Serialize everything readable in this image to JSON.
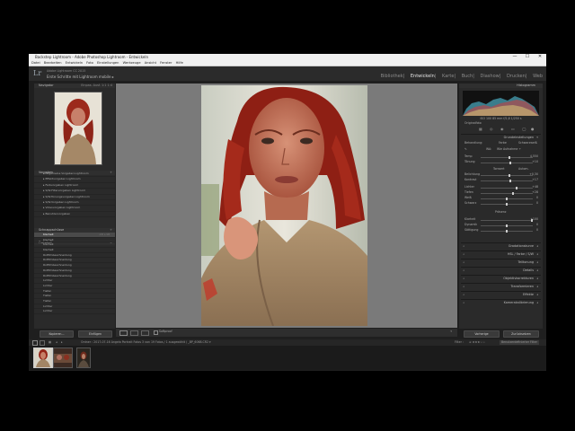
{
  "window": {
    "title": "Backstep Lightroom - Adobe Photoshop Lightroom - Entwickeln",
    "controls": [
      "—",
      "☐",
      "✕"
    ]
  },
  "menu": [
    "Datei",
    "Bearbeiten",
    "Entwickeln",
    "Foto",
    "Einstellungen",
    "Werkzeuge",
    "Ansicht",
    "Fenster",
    "Hilfe"
  ],
  "identity": {
    "logo": "Lr",
    "catalog": "Adobe Lightroom CC 2015",
    "steps": "Erste Schritte mit Lightroom mobile ▸"
  },
  "modules": [
    "Bibliothek",
    "Entwickeln",
    "Karte",
    "Buch",
    "Diashow",
    "Drucken",
    "Web"
  ],
  "active_module": "Entwickeln",
  "left": {
    "navigator": {
      "title": "Navigator",
      "options": "Einpas.  Ausf.  1:1  1:4"
    },
    "presets": {
      "title": "Vorgaben",
      "items": [
        "Allgemeine Vorgaben Lightroom",
        "Effektvorgaben Lightroom",
        "Farbvorgaben Lightroom",
        "S/W-Filtervorgaben Lightroom",
        "S/W-Tonungsvorgaben Lightroom",
        "S/W-Vorgaben Lightroom",
        "Videovorgaben Lightroom",
        "Benutzervorgaben"
      ]
    },
    "snapshots": {
      "title": "Schnappschüsse"
    },
    "history": {
      "title": "Protokoll",
      "items": [
        {
          "label": "Klarheit",
          "a": "-18",
          "b": "+18"
        },
        {
          "label": "Klarheit",
          "a": "",
          "b": ""
        },
        {
          "label": "Klarheit",
          "a": "",
          "b": ""
        },
        {
          "label": "Klarheit",
          "a": "",
          "b": ""
        },
        {
          "label": "Rotfilmbeschneidung",
          "a": "",
          "b": ""
        },
        {
          "label": "Rotfilmbeschneidung",
          "a": "",
          "b": ""
        },
        {
          "label": "Rotfilmbeschneidung",
          "a": "",
          "b": ""
        },
        {
          "label": "Rotfilmbeschneidung",
          "a": "",
          "b": ""
        },
        {
          "label": "Rotfilmbeschneidung",
          "a": "",
          "b": ""
        },
        {
          "label": "Lichter",
          "a": "",
          "b": ""
        },
        {
          "label": "Lichter",
          "a": "",
          "b": ""
        },
        {
          "label": "Tiefen",
          "a": "",
          "b": ""
        },
        {
          "label": "Tiefen",
          "a": "",
          "b": ""
        },
        {
          "label": "Tiefen",
          "a": "",
          "b": ""
        },
        {
          "label": "Lichter",
          "a": "",
          "b": ""
        },
        {
          "label": "Lichter",
          "a": "",
          "b": ""
        }
      ]
    },
    "copy_button": "Kopieren...",
    "paste_button": "Einfügen"
  },
  "right": {
    "histogram": {
      "title": "Histogramm",
      "readout": "ISO 100   85 mm   f/2,8   1/250 s",
      "original": "Originalfoto"
    },
    "basic": {
      "title": "Grundeinstellungen",
      "treatment_label": "Behandlung:",
      "treatment_color": "Farbe",
      "treatment_bw": "Schwarzweiß",
      "wb_label": "WA:",
      "wb_value": "Wie Aufnahme ÷",
      "sliders": [
        {
          "label": "Temp",
          "value": "4.550",
          "pos": 0.55
        },
        {
          "label": "Tönung",
          "value": "+10",
          "pos": 0.58
        },
        {
          "label": "Belichtung",
          "value": "+0,30",
          "pos": 0.55
        },
        {
          "label": "Kontrast",
          "value": "+17",
          "pos": 0.58
        },
        {
          "label": "Lichter",
          "value": "+48",
          "pos": 0.7
        },
        {
          "label": "Tiefen",
          "value": "+28",
          "pos": 0.62
        },
        {
          "label": "Weiß",
          "value": "0",
          "pos": 0.5
        },
        {
          "label": "Schwarz",
          "value": "0",
          "pos": 0.5
        },
        {
          "label": "Klarheit",
          "value": "+100",
          "pos": 1.0
        },
        {
          "label": "Dynamik",
          "value": "0",
          "pos": 0.5
        },
        {
          "label": "Sättigung",
          "value": "0",
          "pos": 0.5
        }
      ],
      "tone_label": "Tonwert",
      "auto": "Autom.",
      "presence_label": "Präsenz"
    },
    "sections": [
      "Gradationskurve",
      "HSL / Farbe / S/W",
      "Teiltonung",
      "Details",
      "Objektivkorrekturen",
      "Transformieren",
      "Effekte",
      "Kamerakalibrierung"
    ],
    "prev_button": "Vorherige",
    "reset_button": "Zurücksetzen"
  },
  "toolbar": {
    "softproof": "Softproof"
  },
  "filmstrip": {
    "path": "Ordner : 2017-07-16 Angela Portrait Fotos   3 von 19 Fotos / 1 ausgewählt / _BP_6068.CR2 ▾",
    "filter_label": "Filter :",
    "filter_value": "Benutzerdefinierter Filter"
  },
  "colors": {
    "accent": "#e6e6e6",
    "panel": "#2a2a2a",
    "background": "#7a7a7a"
  }
}
